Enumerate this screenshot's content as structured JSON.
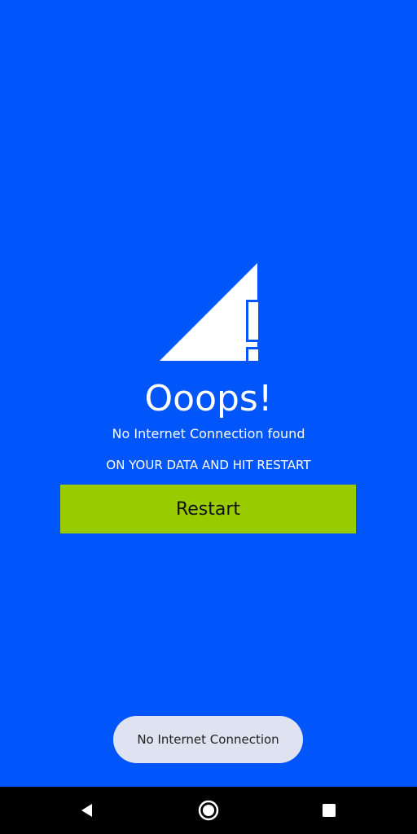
{
  "screen": {
    "background_color": "#0055fb",
    "icon": "no-signal-icon",
    "title": "Ooops!",
    "subtitle": "No Internet Connection found",
    "instruction": "ON YOUR DATA AND HIT RESTART",
    "restart_label": "Restart",
    "restart_color": "#99cc00"
  },
  "toast": {
    "message": "No Internet Connection"
  },
  "navbar": {
    "back_icon": "back-triangle-icon",
    "home_icon": "home-circle-icon",
    "recents_icon": "recents-square-icon"
  }
}
